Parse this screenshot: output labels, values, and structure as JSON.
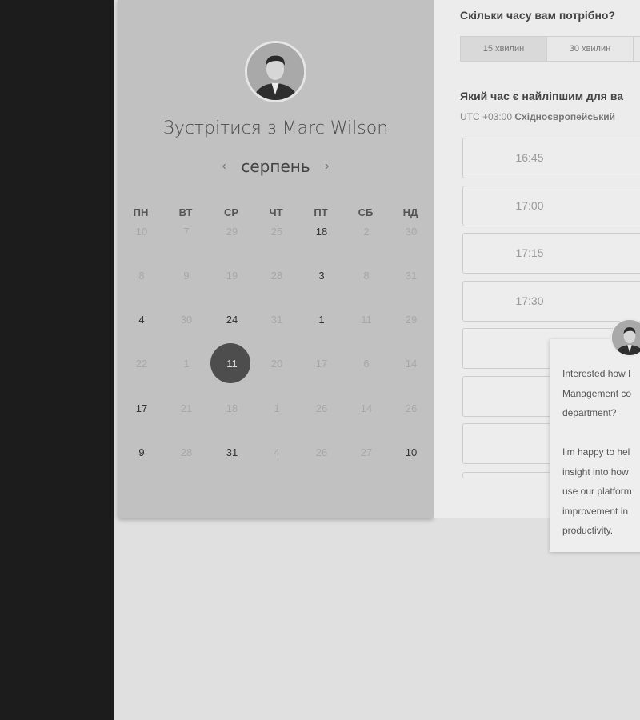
{
  "scheduler": {
    "meet_title": "Зустрітися з Marc Wilson",
    "month": "серпень",
    "prev_arrow": "‹",
    "next_arrow": "›",
    "weekdays": [
      "ПН",
      "ВТ",
      "СР",
      "ЧТ",
      "ПТ",
      "СБ",
      "НД"
    ],
    "weeks": [
      [
        {
          "d": "10"
        },
        {
          "d": "7"
        },
        {
          "d": "29"
        },
        {
          "d": "25"
        },
        {
          "d": "18",
          "avail": true
        },
        {
          "d": "2"
        },
        {
          "d": "30"
        }
      ],
      [
        {
          "d": "8"
        },
        {
          "d": "9"
        },
        {
          "d": "19"
        },
        {
          "d": "28"
        },
        {
          "d": "3",
          "avail": true
        },
        {
          "d": "8"
        },
        {
          "d": "31"
        }
      ],
      [
        {
          "d": "4",
          "avail": true
        },
        {
          "d": "30"
        },
        {
          "d": "24",
          "avail": true
        },
        {
          "d": "31"
        },
        {
          "d": "1",
          "avail": true
        },
        {
          "d": "11"
        },
        {
          "d": "29"
        }
      ],
      [
        {
          "d": "22"
        },
        {
          "d": "1"
        },
        {
          "d": "11",
          "selected": true
        },
        {
          "d": "20"
        },
        {
          "d": "17"
        },
        {
          "d": "6"
        },
        {
          "d": "14"
        }
      ],
      [
        {
          "d": "17",
          "avail": true
        },
        {
          "d": "21"
        },
        {
          "d": "18"
        },
        {
          "d": "1"
        },
        {
          "d": "26"
        },
        {
          "d": "14"
        },
        {
          "d": "26"
        }
      ],
      [
        {
          "d": "9",
          "avail": true
        },
        {
          "d": "28"
        },
        {
          "d": "31",
          "avail": true
        },
        {
          "d": "4"
        },
        {
          "d": "26"
        },
        {
          "d": "27"
        },
        {
          "d": "10",
          "avail": true
        }
      ]
    ]
  },
  "duration": {
    "question": "Скільки часу вам потрібно?",
    "options": [
      "15 хвилин",
      "30 хвилин"
    ],
    "selected_index": 0
  },
  "times": {
    "question": "Який час є найліпшим для ва",
    "timezone_offset": "UTC +03:00",
    "timezone_name": "Східноєвропейський",
    "slots": [
      "16:45",
      "17:00",
      "17:15",
      "17:30",
      "",
      "",
      ""
    ]
  },
  "chat": {
    "message": "Interested how I\nManagement co\ndepartment?\n\nI'm happy to hel\ninsight into how\nuse our platform\nimprovement in\nproductivity."
  }
}
